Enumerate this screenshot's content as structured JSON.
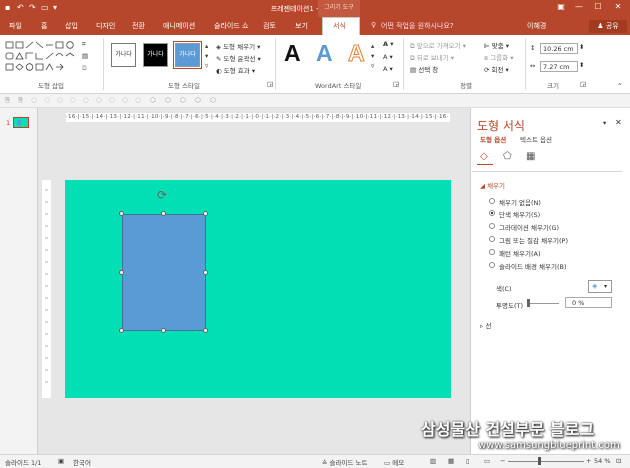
{
  "window": {
    "title": "프레젠테이션1 - PowerPoint",
    "context_tab_group": "그리기 도구",
    "user": "이혜경",
    "share": "공유"
  },
  "tabs": [
    "파일",
    "홈",
    "삽입",
    "디자인",
    "전환",
    "애니메이션",
    "슬라이드 쇼",
    "검토",
    "보기",
    "서식"
  ],
  "tell_me": "어떤 작업을 원하시나요?",
  "ribbon": {
    "groups": [
      "도형 삽입",
      "도형 스타일",
      "WordArt 스타일",
      "정렬",
      "크기"
    ],
    "shape_styles_thumb_text": "가나다",
    "shape_fill": "도형 채우기",
    "shape_outline": "도형 윤곽선",
    "shape_effects": "도형 효과",
    "wordart_letter": "A",
    "bring_forward": "앞으로 가져오기",
    "send_backward": "뒤로 보내기",
    "selection_pane": "선택 창",
    "align": "맞춤",
    "group": "그룹화",
    "rotate": "회전",
    "height": "10.26 cm",
    "width": "7.27 cm"
  },
  "thumb_number": "1",
  "ruler_text": "·16·|·15·|·14·|·13·|·12·|·11·|·10·|·9·|·8·|·7·|·6·|·5·|·4·|·3·|·2·|·1·|·0·|·1·|·2·|·3·|·4·|·5·|·6·|·7·|·8·|·9·|·10·|·11·|·12·|·13·|·14·|·15·|·16·",
  "format_pane": {
    "title": "도형 서식",
    "tab_shape": "도형 옵션",
    "tab_text": "텍스트 옵션",
    "fill_section": "채우기",
    "fill_options": [
      {
        "label": "채우기 없음(N)",
        "checked": false
      },
      {
        "label": "단색 채우기(S)",
        "checked": true
      },
      {
        "label": "그라데이션 채우기(G)",
        "checked": false
      },
      {
        "label": "그림 또는 질감 채우기(P)",
        "checked": false
      },
      {
        "label": "패턴 채우기(A)",
        "checked": false
      },
      {
        "label": "슬라이드 배경 채우기(B)",
        "checked": false
      }
    ],
    "color_label": "색(C)",
    "transparency_label": "투명도(T)",
    "transparency_value": "0 %",
    "line_section": "선"
  },
  "status": {
    "slide": "슬라이드 1/1",
    "language": "한국어",
    "notes": "슬라이드 노트",
    "comments": "메모",
    "zoom": "54 %"
  },
  "watermark": {
    "line1": "삼성물산 건설부문 블로그",
    "line2": "www.samsungblueprint.com"
  },
  "colors": {
    "accent": "#b7472a",
    "slide_bg": "#00e0b4",
    "shape_fill": "#5b9bd5"
  }
}
